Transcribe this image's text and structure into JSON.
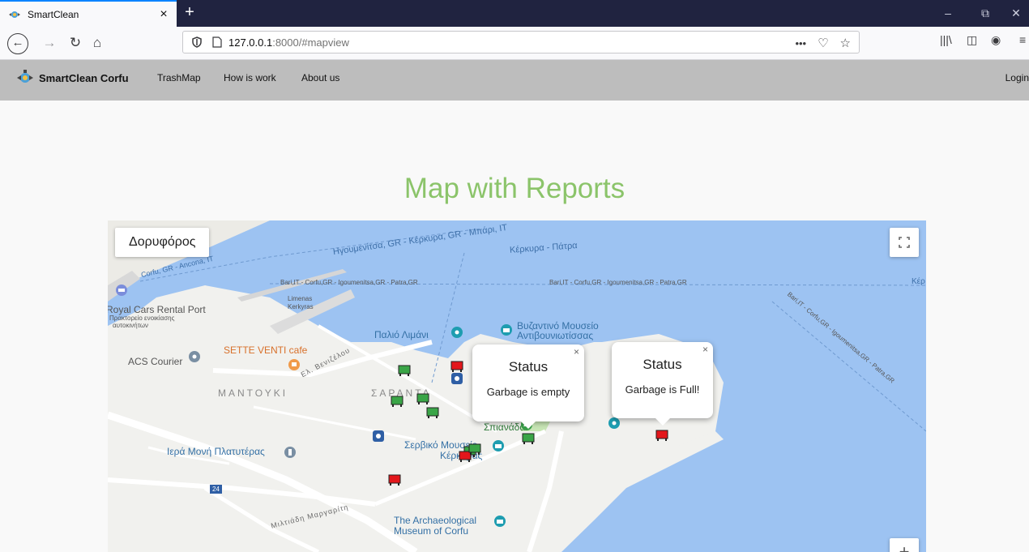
{
  "browser": {
    "tab_title": "SmartClean",
    "tab_close": "×",
    "new_tab": "+",
    "url_host": "127.0.0.1",
    "url_rest": ":8000/#mapview",
    "page_actions": "•••",
    "window_minimize": "–",
    "window_restore": "⧉",
    "window_close": "✕"
  },
  "site": {
    "brand": "SmartClean Corfu",
    "nav": [
      "TrashMap",
      "How is work",
      "About us"
    ],
    "login": "Login"
  },
  "page": {
    "heading": "Map with Reports"
  },
  "map": {
    "satellite_button": "Δορυφόρος",
    "zoom_in": "+",
    "labels": {
      "ferry1": "Ηγουμενίτσα, GR - Κέρκυρα, GR - Μπάρι, IT",
      "ferry2": "Κέρκυρα - Πάτρα",
      "ferry3": "Corfu, GR - Ancona, IT",
      "ferry4": "Bari,IT - Corfu,GR - Igoumenitsa,GR - Patra,GR",
      "ferry5": "Bari,IT - Corfu,GR - Igoumenitsa,GR - Patra,GR",
      "ferry6": "Bari,IT - Corfu,GR - Igoumenitsa,GR - Patra,GR",
      "limenas1": "Limenas",
      "limenas2": "Kerkyras",
      "royal1": "Royal Cars Rental Port",
      "royal2": "Πρακτορείο ενοικίασης",
      "royal3": "αυτοκινήτων",
      "sette": "SETTE VENTI cafe",
      "acs": "ACS Courier",
      "old_port": "Παλιό Λιμάνι",
      "byz1": "Βυζαντινό Μουσείο",
      "byz2": "Αντιβουνιωτίσσας",
      "mantouki": "ΜΑΝΤΟΥΚΙ",
      "saranta": "ΣΑΡΑΝΤΑ",
      "spianada": "Σπιανάδα",
      "serb1": "Σερβικό Μουσείο",
      "serb2": "Κέρκυρας",
      "moni": "Ιερά Μονή Πλατυτέρας",
      "arch1": "The Archaeological",
      "arch2": "Museum of Corfu",
      "veniz": "Ελ. Βενιζέλου",
      "mitr": "Μιλτιάδη Μαργαρίτη",
      "road24": "24",
      "kerkyra_edge": "Κέρ"
    },
    "info_windows": [
      {
        "title": "Status",
        "body": "Garbage is empty",
        "close": "×"
      },
      {
        "title": "Status",
        "body": "Garbage is Full!",
        "close": "×"
      }
    ],
    "markers": [
      {
        "type": "green-bin"
      },
      {
        "type": "red-bin"
      },
      {
        "type": "blue-recycle"
      },
      {
        "type": "green-bin"
      },
      {
        "type": "green-bin"
      },
      {
        "type": "green-bin"
      },
      {
        "type": "green-bin"
      },
      {
        "type": "blue-recycle"
      },
      {
        "type": "green-bin"
      },
      {
        "type": "red-bin"
      },
      {
        "type": "red-bin"
      },
      {
        "type": "green-bin"
      },
      {
        "type": "red-bin"
      }
    ],
    "colors": {
      "full": "#e3171b",
      "empty": "#3aa547",
      "recycle": "#2f5fa5",
      "water": "#9dc3f2",
      "land": "#f1f1ee"
    }
  }
}
